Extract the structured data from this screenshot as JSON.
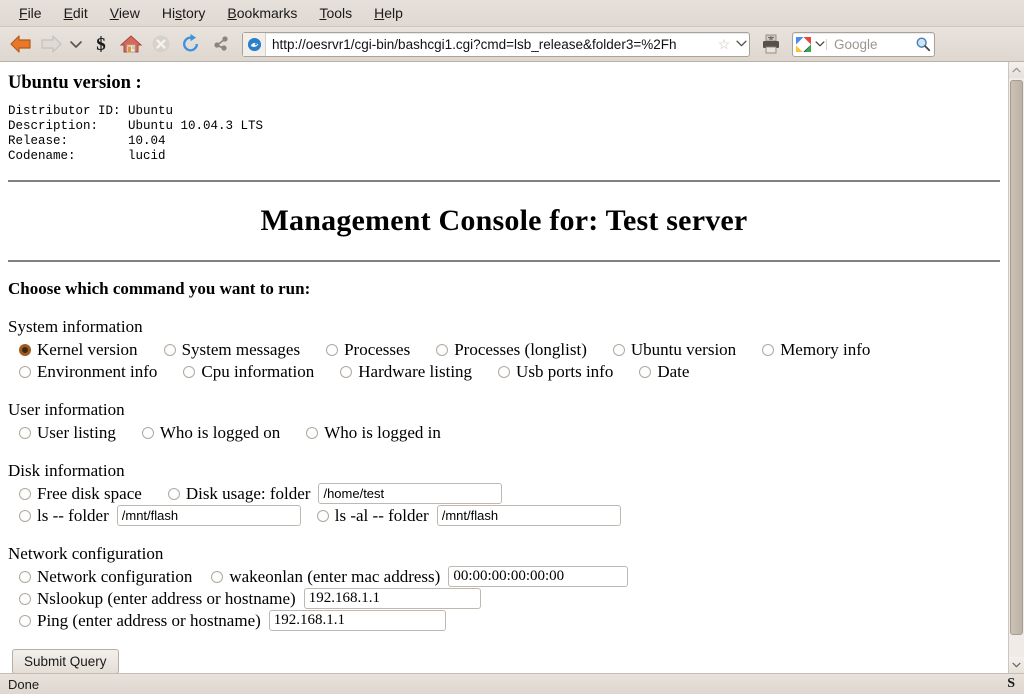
{
  "browser": {
    "menus": [
      {
        "label": "File",
        "accel": "F"
      },
      {
        "label": "Edit",
        "accel": "E"
      },
      {
        "label": "View",
        "accel": "V"
      },
      {
        "label": "History",
        "accel": "s"
      },
      {
        "label": "Bookmarks",
        "accel": "B"
      },
      {
        "label": "Tools",
        "accel": "T"
      },
      {
        "label": "Help",
        "accel": "H"
      }
    ],
    "toolbar": {
      "back": "back-icon",
      "forward": "forward-icon",
      "history_dropdown": "chevron-down-icon",
      "stumble": "s-icon",
      "home": "home-icon",
      "stop": "stop-icon",
      "reload": "reload-icon",
      "share": "share-icon",
      "print": "printer-icon"
    },
    "url": "http://oesrvr1/cgi-bin/bashcgi1.cgi?cmd=lsb_release&folder3=%2Fh",
    "bookmark_star": "star-icon",
    "url_dropdown": "chevron-down-icon",
    "search": {
      "engine": "google-icon",
      "placeholder": "Google",
      "go_icon": "magnifier-icon"
    },
    "status": {
      "text": "Done",
      "right_icon": "S"
    }
  },
  "page": {
    "ubuntu_heading": "Ubuntu version :",
    "ubuntu_output": "Distributor ID: Ubuntu\nDescription:    Ubuntu 10.04.3 LTS\nRelease:        10.04\nCodename:       lucid",
    "console_title": "Management Console for: Test server",
    "choose_text": "Choose which command you want to run:",
    "groups": [
      {
        "label": "System information",
        "rows": [
          [
            {
              "label": "Kernel version",
              "checked": true
            },
            {
              "label": "System messages",
              "checked": false
            },
            {
              "label": "Processes",
              "checked": false
            },
            {
              "label": "Processes (longlist)",
              "checked": false
            },
            {
              "label": "Ubuntu version",
              "checked": false
            },
            {
              "label": "Memory info",
              "checked": false
            }
          ],
          [
            {
              "label": "Environment info",
              "checked": false
            },
            {
              "label": "Cpu information",
              "checked": false
            },
            {
              "label": "Hardware listing",
              "checked": false
            },
            {
              "label": "Usb ports info",
              "checked": false
            },
            {
              "label": "Date",
              "checked": false
            }
          ]
        ]
      },
      {
        "label": "User information",
        "rows": [
          [
            {
              "label": "User listing",
              "checked": false
            },
            {
              "label": "Who is logged on",
              "checked": false
            },
            {
              "label": "Who is logged in",
              "checked": false
            }
          ]
        ]
      }
    ],
    "disk": {
      "label": "Disk information",
      "free_disk_space": "Free disk space",
      "disk_usage_label": "Disk usage: folder",
      "disk_usage_value": "/home/test",
      "ls_label": "ls -- folder",
      "ls_value": "/mnt/flash",
      "lsal_label": "ls -al -- folder",
      "lsal_value": "/mnt/flash"
    },
    "network": {
      "label": "Network configuration",
      "netconf_label": "Network configuration",
      "wakeonlan_label": "wakeonlan (enter mac address)",
      "wakeonlan_value": "00:00:00:00:00:00",
      "nslookup_label": "Nslookup (enter address or hostname)",
      "nslookup_value": "192.168.1.1",
      "ping_label": "Ping (enter address or hostname)",
      "ping_value": "192.168.1.1"
    },
    "submit_label": "Submit Query"
  }
}
